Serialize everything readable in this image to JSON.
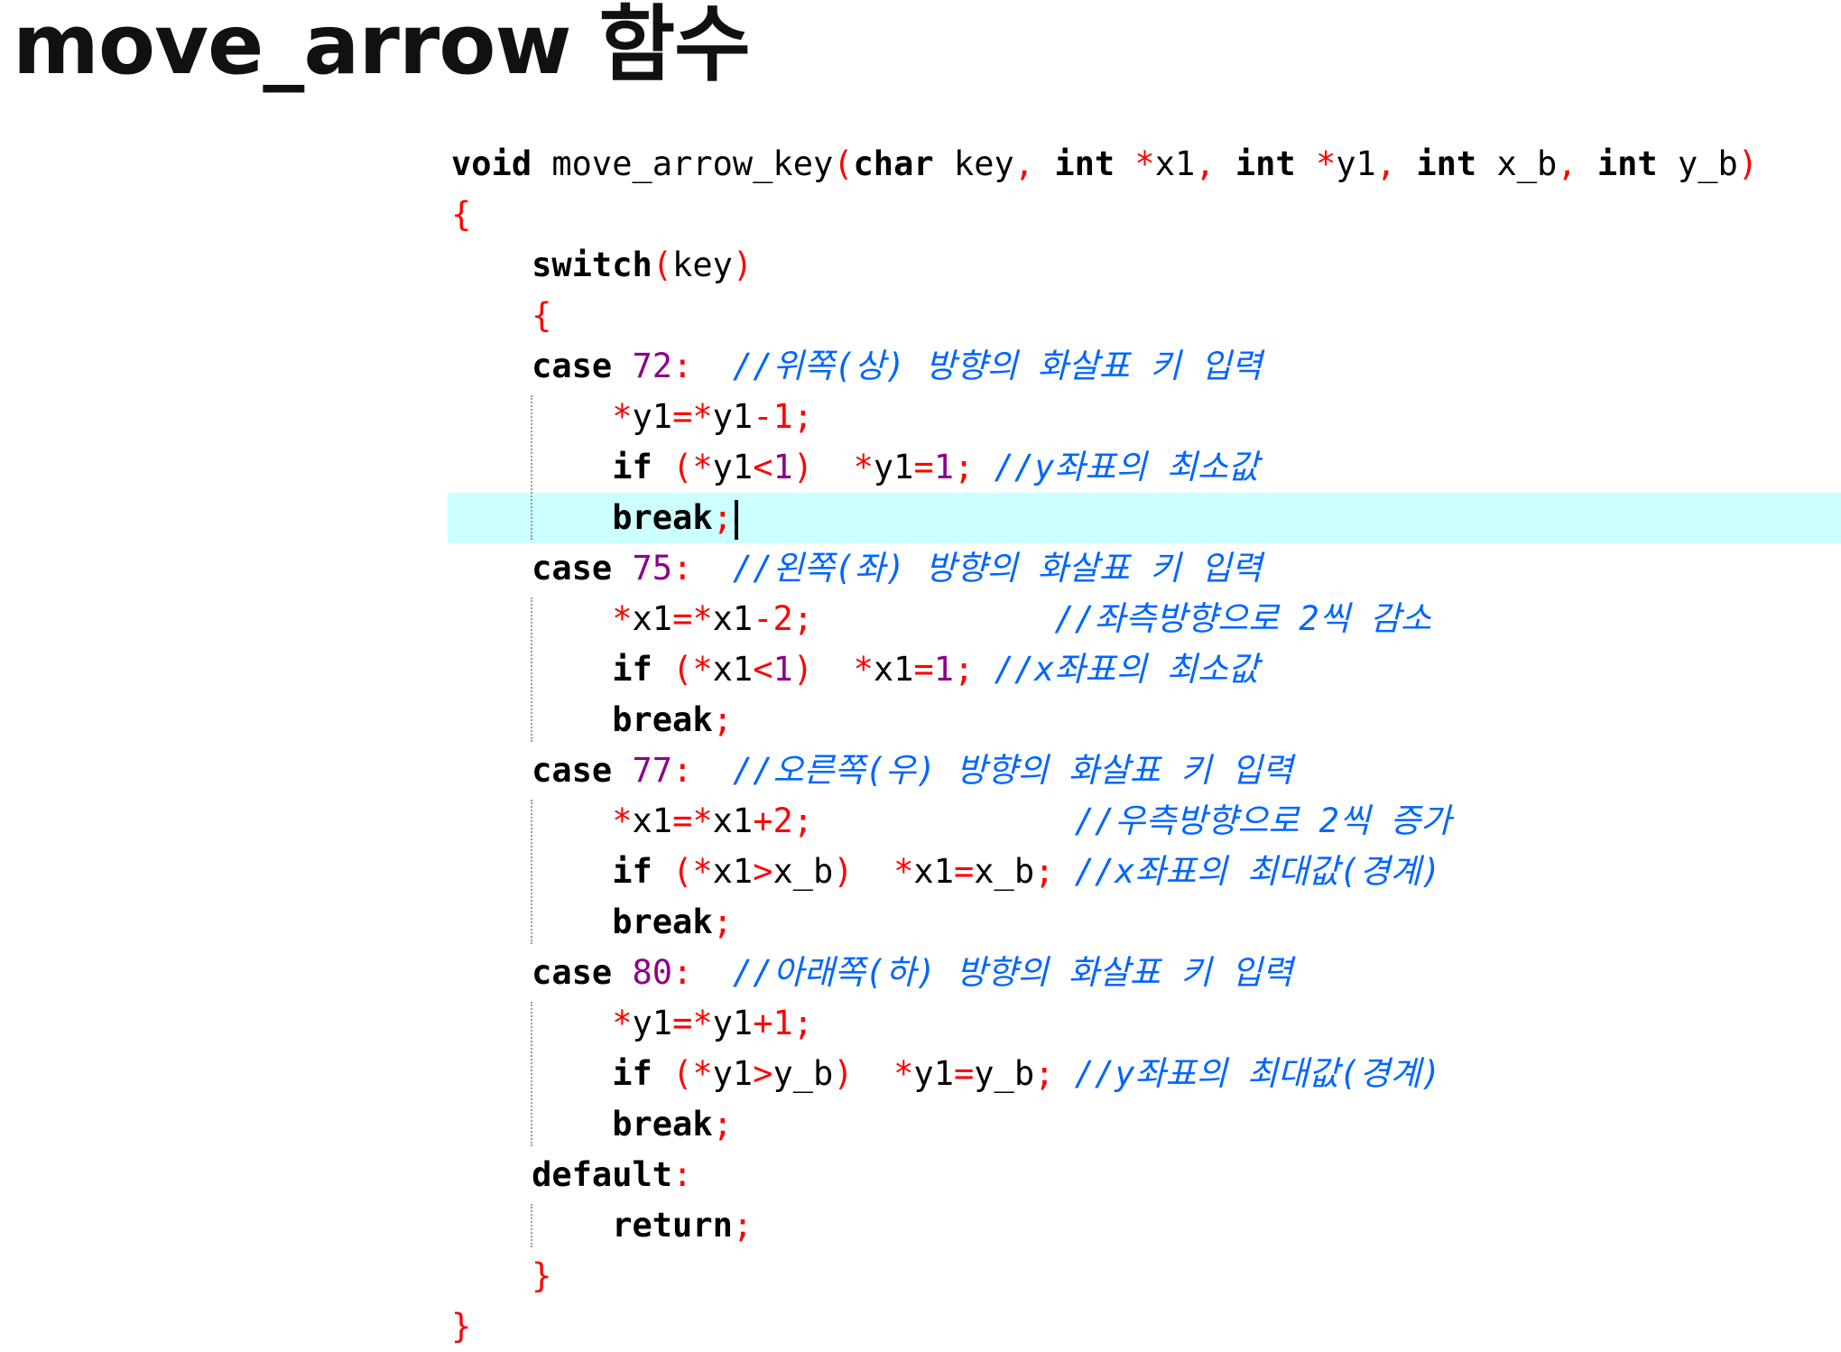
{
  "slide": {
    "title": "move_arrow 함수"
  },
  "code": {
    "lines": [
      [
        {
          "t": "kw",
          "v": "void"
        },
        {
          "t": "plain",
          "v": " move_arrow_key"
        },
        {
          "t": "op",
          "v": "("
        },
        {
          "t": "kw",
          "v": "char"
        },
        {
          "t": "plain",
          "v": " key"
        },
        {
          "t": "op",
          "v": ","
        },
        {
          "t": "plain",
          "v": " "
        },
        {
          "t": "kw",
          "v": "int"
        },
        {
          "t": "plain",
          "v": " "
        },
        {
          "t": "op",
          "v": "*"
        },
        {
          "t": "plain",
          "v": "x1"
        },
        {
          "t": "op",
          "v": ","
        },
        {
          "t": "plain",
          "v": " "
        },
        {
          "t": "kw",
          "v": "int"
        },
        {
          "t": "plain",
          "v": " "
        },
        {
          "t": "op",
          "v": "*"
        },
        {
          "t": "plain",
          "v": "y1"
        },
        {
          "t": "op",
          "v": ","
        },
        {
          "t": "plain",
          "v": " "
        },
        {
          "t": "kw",
          "v": "int"
        },
        {
          "t": "plain",
          "v": " x_b"
        },
        {
          "t": "op",
          "v": ","
        },
        {
          "t": "plain",
          "v": " "
        },
        {
          "t": "kw",
          "v": "int"
        },
        {
          "t": "plain",
          "v": " y_b"
        },
        {
          "t": "op",
          "v": ")"
        }
      ],
      [
        {
          "t": "op",
          "v": "{"
        }
      ],
      [
        {
          "t": "plain",
          "v": "    "
        },
        {
          "t": "kw",
          "v": "switch"
        },
        {
          "t": "op",
          "v": "("
        },
        {
          "t": "plain",
          "v": "key"
        },
        {
          "t": "op",
          "v": ")"
        }
      ],
      [
        {
          "t": "plain",
          "v": "    "
        },
        {
          "t": "op",
          "v": "{"
        }
      ],
      [
        {
          "t": "plain",
          "v": "    "
        },
        {
          "t": "kw",
          "v": "case"
        },
        {
          "t": "plain",
          "v": " "
        },
        {
          "t": "num",
          "v": "72"
        },
        {
          "t": "op",
          "v": ":"
        },
        {
          "t": "plain",
          "v": "  "
        },
        {
          "t": "cmt",
          "v": "//위쪽(상) 방향의 화살표 키 입력"
        }
      ],
      [
        {
          "t": "plain",
          "v": "        "
        },
        {
          "t": "op",
          "v": "*"
        },
        {
          "t": "plain",
          "v": "y1"
        },
        {
          "t": "op",
          "v": "=*"
        },
        {
          "t": "plain",
          "v": "y1"
        },
        {
          "t": "op",
          "v": "-1;"
        }
      ],
      [
        {
          "t": "plain",
          "v": "        "
        },
        {
          "t": "kw",
          "v": "if"
        },
        {
          "t": "plain",
          "v": " "
        },
        {
          "t": "op",
          "v": "(*"
        },
        {
          "t": "plain",
          "v": "y1"
        },
        {
          "t": "op",
          "v": "<"
        },
        {
          "t": "num",
          "v": "1"
        },
        {
          "t": "op",
          "v": ")"
        },
        {
          "t": "plain",
          "v": "  "
        },
        {
          "t": "op",
          "v": "*"
        },
        {
          "t": "plain",
          "v": "y1"
        },
        {
          "t": "op",
          "v": "="
        },
        {
          "t": "num",
          "v": "1"
        },
        {
          "t": "op",
          "v": ";"
        },
        {
          "t": "plain",
          "v": " "
        },
        {
          "t": "cmt",
          "v": "//y좌표의 최소값"
        }
      ],
      [
        {
          "t": "plain",
          "v": "        "
        },
        {
          "t": "kw",
          "v": "break"
        },
        {
          "t": "op",
          "v": ";"
        },
        {
          "t": "caret",
          "v": ""
        }
      ],
      [
        {
          "t": "plain",
          "v": "    "
        },
        {
          "t": "kw",
          "v": "case"
        },
        {
          "t": "plain",
          "v": " "
        },
        {
          "t": "num",
          "v": "75"
        },
        {
          "t": "op",
          "v": ":"
        },
        {
          "t": "plain",
          "v": "  "
        },
        {
          "t": "cmt",
          "v": "//왼쪽(좌) 방향의 화살표 키 입력"
        }
      ],
      [
        {
          "t": "plain",
          "v": "        "
        },
        {
          "t": "op",
          "v": "*"
        },
        {
          "t": "plain",
          "v": "x1"
        },
        {
          "t": "op",
          "v": "=*"
        },
        {
          "t": "plain",
          "v": "x1"
        },
        {
          "t": "op",
          "v": "-2;"
        },
        {
          "t": "plain",
          "v": "            "
        },
        {
          "t": "cmt",
          "v": "//좌측방향으로 2씩 감소"
        }
      ],
      [
        {
          "t": "plain",
          "v": "        "
        },
        {
          "t": "kw",
          "v": "if"
        },
        {
          "t": "plain",
          "v": " "
        },
        {
          "t": "op",
          "v": "(*"
        },
        {
          "t": "plain",
          "v": "x1"
        },
        {
          "t": "op",
          "v": "<"
        },
        {
          "t": "num",
          "v": "1"
        },
        {
          "t": "op",
          "v": ")"
        },
        {
          "t": "plain",
          "v": "  "
        },
        {
          "t": "op",
          "v": "*"
        },
        {
          "t": "plain",
          "v": "x1"
        },
        {
          "t": "op",
          "v": "="
        },
        {
          "t": "num",
          "v": "1"
        },
        {
          "t": "op",
          "v": ";"
        },
        {
          "t": "plain",
          "v": " "
        },
        {
          "t": "cmt",
          "v": "//x좌표의 최소값"
        }
      ],
      [
        {
          "t": "plain",
          "v": "        "
        },
        {
          "t": "kw",
          "v": "break"
        },
        {
          "t": "op",
          "v": ";"
        }
      ],
      [
        {
          "t": "plain",
          "v": "    "
        },
        {
          "t": "kw",
          "v": "case"
        },
        {
          "t": "plain",
          "v": " "
        },
        {
          "t": "num",
          "v": "77"
        },
        {
          "t": "op",
          "v": ":"
        },
        {
          "t": "plain",
          "v": "  "
        },
        {
          "t": "cmt",
          "v": "//오른쪽(우) 방향의 화살표 키 입력"
        }
      ],
      [
        {
          "t": "plain",
          "v": "        "
        },
        {
          "t": "op",
          "v": "*"
        },
        {
          "t": "plain",
          "v": "x1"
        },
        {
          "t": "op",
          "v": "=*"
        },
        {
          "t": "plain",
          "v": "x1"
        },
        {
          "t": "op",
          "v": "+2;"
        },
        {
          "t": "plain",
          "v": "             "
        },
        {
          "t": "cmt",
          "v": "//우측방향으로 2씩 증가"
        }
      ],
      [
        {
          "t": "plain",
          "v": "        "
        },
        {
          "t": "kw",
          "v": "if"
        },
        {
          "t": "plain",
          "v": " "
        },
        {
          "t": "op",
          "v": "(*"
        },
        {
          "t": "plain",
          "v": "x1"
        },
        {
          "t": "op",
          "v": ">"
        },
        {
          "t": "plain",
          "v": "x_b"
        },
        {
          "t": "op",
          "v": ")"
        },
        {
          "t": "plain",
          "v": "  "
        },
        {
          "t": "op",
          "v": "*"
        },
        {
          "t": "plain",
          "v": "x1"
        },
        {
          "t": "op",
          "v": "="
        },
        {
          "t": "plain",
          "v": "x_b"
        },
        {
          "t": "op",
          "v": ";"
        },
        {
          "t": "plain",
          "v": " "
        },
        {
          "t": "cmt",
          "v": "//x좌표의 최대값(경계)"
        }
      ],
      [
        {
          "t": "plain",
          "v": "        "
        },
        {
          "t": "kw",
          "v": "break"
        },
        {
          "t": "op",
          "v": ";"
        }
      ],
      [
        {
          "t": "plain",
          "v": "    "
        },
        {
          "t": "kw",
          "v": "case"
        },
        {
          "t": "plain",
          "v": " "
        },
        {
          "t": "num",
          "v": "80"
        },
        {
          "t": "op",
          "v": ":"
        },
        {
          "t": "plain",
          "v": "  "
        },
        {
          "t": "cmt",
          "v": "//아래쪽(하) 방향의 화살표 키 입력"
        }
      ],
      [
        {
          "t": "plain",
          "v": "        "
        },
        {
          "t": "op",
          "v": "*"
        },
        {
          "t": "plain",
          "v": "y1"
        },
        {
          "t": "op",
          "v": "=*"
        },
        {
          "t": "plain",
          "v": "y1"
        },
        {
          "t": "op",
          "v": "+1;"
        }
      ],
      [
        {
          "t": "plain",
          "v": "        "
        },
        {
          "t": "kw",
          "v": "if"
        },
        {
          "t": "plain",
          "v": " "
        },
        {
          "t": "op",
          "v": "(*"
        },
        {
          "t": "plain",
          "v": "y1"
        },
        {
          "t": "op",
          "v": ">"
        },
        {
          "t": "plain",
          "v": "y_b"
        },
        {
          "t": "op",
          "v": ")"
        },
        {
          "t": "plain",
          "v": "  "
        },
        {
          "t": "op",
          "v": "*"
        },
        {
          "t": "plain",
          "v": "y1"
        },
        {
          "t": "op",
          "v": "="
        },
        {
          "t": "plain",
          "v": "y_b"
        },
        {
          "t": "op",
          "v": ";"
        },
        {
          "t": "plain",
          "v": " "
        },
        {
          "t": "cmt",
          "v": "//y좌표의 최대값(경계)"
        }
      ],
      [
        {
          "t": "plain",
          "v": "        "
        },
        {
          "t": "kw",
          "v": "break"
        },
        {
          "t": "op",
          "v": ";"
        }
      ],
      [
        {
          "t": "plain",
          "v": "    "
        },
        {
          "t": "kw",
          "v": "default"
        },
        {
          "t": "op",
          "v": ":"
        }
      ],
      [
        {
          "t": "plain",
          "v": "        "
        },
        {
          "t": "kw",
          "v": "return"
        },
        {
          "t": "op",
          "v": ";"
        }
      ],
      [
        {
          "t": "plain",
          "v": "    "
        },
        {
          "t": "op",
          "v": "}"
        }
      ],
      [
        {
          "t": "op",
          "v": "}"
        }
      ]
    ],
    "current_line": 7
  },
  "colors": {
    "keyword": "#000000",
    "operator": "#ff0000",
    "number": "#8b008b",
    "comment": "#0066ff",
    "current_line_highlight": "#ccffff"
  }
}
